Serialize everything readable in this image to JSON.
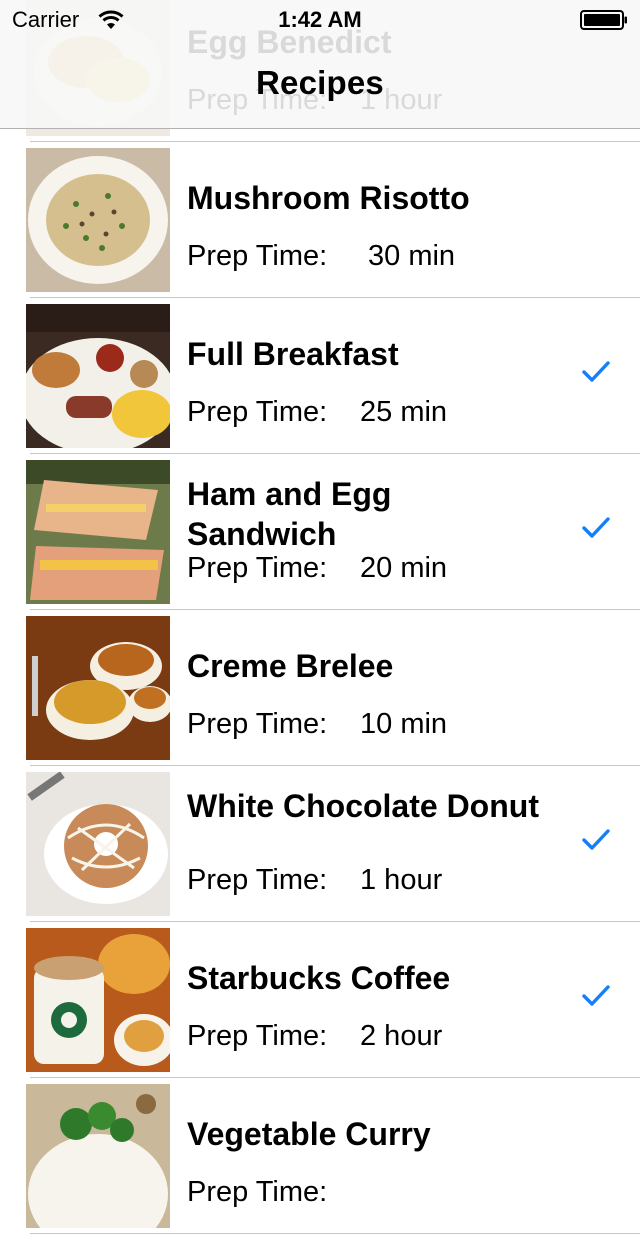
{
  "status_bar": {
    "carrier": "Carrier",
    "time": "1:42 AM",
    "wifi_icon": "wifi-icon",
    "battery_icon": "battery-icon"
  },
  "nav": {
    "title": "Recipes"
  },
  "accent_color": "#157efb",
  "recipes": [
    {
      "name": "Egg Benedict",
      "prep_label": "Prep Time:",
      "prep_value": "1 hour",
      "checked": false
    },
    {
      "name": "Mushroom Risotto",
      "prep_label": "Prep Time:",
      "prep_value": "30 min",
      "checked": false
    },
    {
      "name": "Full Breakfast",
      "prep_label": "Prep Time:",
      "prep_value": "25 min",
      "checked": true
    },
    {
      "name": "Ham and Egg Sandwich",
      "prep_label": "Prep Time:",
      "prep_value": "20 min",
      "checked": true
    },
    {
      "name": "Creme Brelee",
      "prep_label": "Prep Time:",
      "prep_value": "10 min",
      "checked": false
    },
    {
      "name": "White Chocolate Donut",
      "prep_label": "Prep Time:",
      "prep_value": "1 hour",
      "checked": true
    },
    {
      "name": "Starbucks Coffee",
      "prep_label": "Prep Time:",
      "prep_value": "2 hour",
      "checked": true
    },
    {
      "name": "Vegetable Curry",
      "prep_label": "Prep Time:",
      "prep_value": "",
      "checked": false
    }
  ]
}
